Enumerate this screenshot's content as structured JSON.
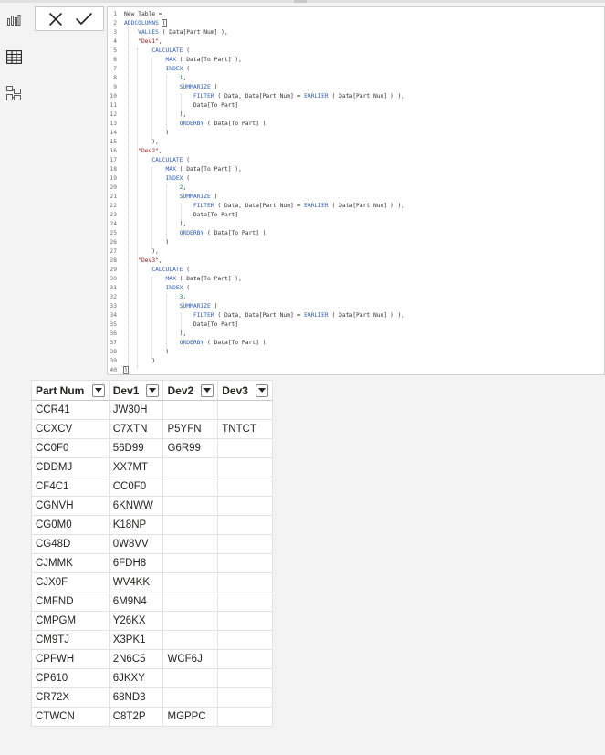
{
  "code_lines": [
    [
      {
        "t": "New Table = ",
        "c": ""
      }
    ],
    [
      {
        "t": "ADDCOLUMNS ",
        "c": "fn"
      },
      {
        "t": "(",
        "c": "cursor-after"
      }
    ],
    [
      {
        "t": "    ",
        "c": ""
      },
      {
        "t": "VALUES",
        "c": "fn"
      },
      {
        "t": " ( Data[Part Num] ),",
        "c": ""
      }
    ],
    [
      {
        "t": "    ",
        "c": ""
      },
      {
        "t": "\"Dev1\"",
        "c": "str"
      },
      {
        "t": ",",
        "c": ""
      }
    ],
    [
      {
        "t": "        ",
        "c": ""
      },
      {
        "t": "CALCULATE",
        "c": "fn"
      },
      {
        "t": " (",
        "c": ""
      }
    ],
    [
      {
        "t": "            ",
        "c": ""
      },
      {
        "t": "MAX",
        "c": "fn"
      },
      {
        "t": " ( Data[To Part] ),",
        "c": ""
      }
    ],
    [
      {
        "t": "            ",
        "c": ""
      },
      {
        "t": "INDEX",
        "c": "fn"
      },
      {
        "t": " (",
        "c": ""
      }
    ],
    [
      {
        "t": "                ",
        "c": ""
      },
      {
        "t": "1",
        "c": "num"
      },
      {
        "t": ",",
        "c": ""
      }
    ],
    [
      {
        "t": "                ",
        "c": ""
      },
      {
        "t": "SUMMARIZE",
        "c": "fn"
      },
      {
        "t": " (",
        "c": ""
      }
    ],
    [
      {
        "t": "                    ",
        "c": ""
      },
      {
        "t": "FILTER",
        "c": "fn"
      },
      {
        "t": " ( Data, Data[Part Num] = ",
        "c": ""
      },
      {
        "t": "EARLIER",
        "c": "fn"
      },
      {
        "t": " ( Data[Part Num] ) ),",
        "c": ""
      }
    ],
    [
      {
        "t": "                    Data[To Part]",
        "c": ""
      }
    ],
    [
      {
        "t": "                ),",
        "c": ""
      }
    ],
    [
      {
        "t": "                ",
        "c": ""
      },
      {
        "t": "ORDERBY",
        "c": "fn"
      },
      {
        "t": " ( Data[To Part] )",
        "c": ""
      }
    ],
    [
      {
        "t": "            )",
        "c": ""
      }
    ],
    [
      {
        "t": "        ),",
        "c": ""
      }
    ],
    [
      {
        "t": "    ",
        "c": ""
      },
      {
        "t": "\"Dev2\"",
        "c": "str"
      },
      {
        "t": ",",
        "c": ""
      }
    ],
    [
      {
        "t": "        ",
        "c": ""
      },
      {
        "t": "CALCULATE",
        "c": "fn"
      },
      {
        "t": " (",
        "c": ""
      }
    ],
    [
      {
        "t": "            ",
        "c": ""
      },
      {
        "t": "MAX",
        "c": "fn"
      },
      {
        "t": " ( Data[To Part] ),",
        "c": ""
      }
    ],
    [
      {
        "t": "            ",
        "c": ""
      },
      {
        "t": "INDEX",
        "c": "fn"
      },
      {
        "t": " (",
        "c": ""
      }
    ],
    [
      {
        "t": "                ",
        "c": ""
      },
      {
        "t": "2",
        "c": "num"
      },
      {
        "t": ",",
        "c": ""
      }
    ],
    [
      {
        "t": "                ",
        "c": ""
      },
      {
        "t": "SUMMARIZE",
        "c": "fn"
      },
      {
        "t": " (",
        "c": ""
      }
    ],
    [
      {
        "t": "                    ",
        "c": ""
      },
      {
        "t": "FILTER",
        "c": "fn"
      },
      {
        "t": " ( Data, Data[Part Num] = ",
        "c": ""
      },
      {
        "t": "EARLIER",
        "c": "fn"
      },
      {
        "t": " ( Data[Part Num] ) ),",
        "c": ""
      }
    ],
    [
      {
        "t": "                    Data[To Part]",
        "c": ""
      }
    ],
    [
      {
        "t": "                ),",
        "c": ""
      }
    ],
    [
      {
        "t": "                ",
        "c": ""
      },
      {
        "t": "ORDERBY",
        "c": "fn"
      },
      {
        "t": " ( Data[To Part] )",
        "c": ""
      }
    ],
    [
      {
        "t": "            )",
        "c": ""
      }
    ],
    [
      {
        "t": "        ),",
        "c": ""
      }
    ],
    [
      {
        "t": "    ",
        "c": ""
      },
      {
        "t": "\"Dev3\"",
        "c": "str"
      },
      {
        "t": ",",
        "c": ""
      }
    ],
    [
      {
        "t": "        ",
        "c": ""
      },
      {
        "t": "CALCULATE",
        "c": "fn"
      },
      {
        "t": " (",
        "c": ""
      }
    ],
    [
      {
        "t": "            ",
        "c": ""
      },
      {
        "t": "MAX",
        "c": "fn"
      },
      {
        "t": " ( Data[To Part] ),",
        "c": ""
      }
    ],
    [
      {
        "t": "            ",
        "c": ""
      },
      {
        "t": "INDEX",
        "c": "fn"
      },
      {
        "t": " (",
        "c": ""
      }
    ],
    [
      {
        "t": "                ",
        "c": ""
      },
      {
        "t": "3",
        "c": "num"
      },
      {
        "t": ",",
        "c": ""
      }
    ],
    [
      {
        "t": "                ",
        "c": ""
      },
      {
        "t": "SUMMARIZE",
        "c": "fn"
      },
      {
        "t": " (",
        "c": ""
      }
    ],
    [
      {
        "t": "                    ",
        "c": ""
      },
      {
        "t": "FILTER",
        "c": "fn"
      },
      {
        "t": " ( Data, Data[Part Num] = ",
        "c": ""
      },
      {
        "t": "EARLIER",
        "c": "fn"
      },
      {
        "t": " ( Data[Part Num] ) ),",
        "c": ""
      }
    ],
    [
      {
        "t": "                    Data[To Part]",
        "c": ""
      }
    ],
    [
      {
        "t": "                ),",
        "c": ""
      }
    ],
    [
      {
        "t": "                ",
        "c": ""
      },
      {
        "t": "ORDERBY",
        "c": "fn"
      },
      {
        "t": " ( Data[To Part] )",
        "c": ""
      }
    ],
    [
      {
        "t": "            )",
        "c": ""
      }
    ],
    [
      {
        "t": "        )",
        "c": ""
      }
    ],
    [
      {
        "t": ")",
        "c": "boxed"
      }
    ]
  ],
  "table": {
    "headers": [
      "Part Num",
      "Dev1",
      "Dev2",
      "Dev3"
    ],
    "rows": [
      [
        "CCR41",
        "JW30H",
        "",
        ""
      ],
      [
        "CCXCV",
        "C7XTN",
        "P5YFN",
        "TNTCT"
      ],
      [
        "CC0F0",
        "56D99",
        "G6R99",
        ""
      ],
      [
        "CDDMJ",
        "XX7MT",
        "",
        ""
      ],
      [
        "CF4C1",
        "CC0F0",
        "",
        ""
      ],
      [
        "CGNVH",
        "6KNWW",
        "",
        ""
      ],
      [
        "CG0M0",
        "K18NP",
        "",
        ""
      ],
      [
        "CG48D",
        "0W8VV",
        "",
        ""
      ],
      [
        "CJMMK",
        "6FDH8",
        "",
        ""
      ],
      [
        "CJX0F",
        "WV4KK",
        "",
        ""
      ],
      [
        "CMFND",
        "6M9N4",
        "",
        ""
      ],
      [
        "CMPGM",
        "Y26KX",
        "",
        ""
      ],
      [
        "CM9TJ",
        "X3PK1",
        "",
        ""
      ],
      [
        "CPFWH",
        "2N6C5",
        "WCF6J",
        ""
      ],
      [
        "CP610",
        "6JKXY",
        "",
        ""
      ],
      [
        "CR72X",
        "68ND3",
        "",
        ""
      ],
      [
        "CTWCN",
        "C8T2P",
        "MGPPC",
        ""
      ]
    ]
  },
  "icons": {
    "rail": [
      "report-view-icon",
      "table-view-icon",
      "model-view-icon"
    ],
    "commit": [
      "cancel-x-icon",
      "commit-check-icon"
    ]
  },
  "colors": {
    "keyword": "#2d5fb4",
    "string": "#a31515",
    "number": "#098658"
  }
}
